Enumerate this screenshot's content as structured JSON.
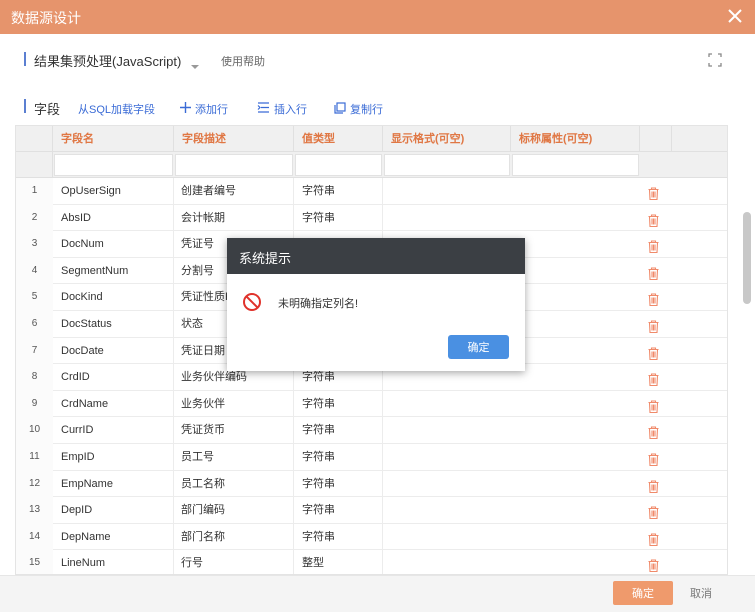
{
  "window": {
    "title": "数据源设计"
  },
  "section1": {
    "title": "结果集预处理(JavaScript)",
    "help": "使用帮助"
  },
  "section2": {
    "title": "字段",
    "tools": [
      "从SQL加载字段",
      "插入行",
      "插入行",
      "复制行"
    ]
  },
  "toolbar": {
    "load_sql": "从SQL加载字段",
    "add_row": "添加行",
    "insert_row": "插入行",
    "copy_row": "复制行"
  },
  "grid": {
    "headers": [
      "字段名",
      "字段描述",
      "值类型",
      "显示格式(可空)",
      "标称属性(可空)"
    ],
    "rows": [
      {
        "idx": "1",
        "name": "OpUserSign",
        "desc": "创建者编号",
        "type": "字符串"
      },
      {
        "idx": "2",
        "name": "AbsID",
        "desc": "会计帐期",
        "type": "字符串"
      },
      {
        "idx": "3",
        "name": "DocNum",
        "desc": "凭证号",
        "type": ""
      },
      {
        "idx": "4",
        "name": "SegmentNum",
        "desc": "分割号",
        "type": ""
      },
      {
        "idx": "5",
        "name": "DocKind",
        "desc": "凭证性质H",
        "type": ""
      },
      {
        "idx": "6",
        "name": "DocStatus",
        "desc": "状态",
        "type": ""
      },
      {
        "idx": "7",
        "name": "DocDate",
        "desc": "凭证日期",
        "type": ""
      },
      {
        "idx": "8",
        "name": "CrdID",
        "desc": "业务伙伴编码",
        "type": "字符串"
      },
      {
        "idx": "9",
        "name": "CrdName",
        "desc": "业务伙伴",
        "type": "字符串"
      },
      {
        "idx": "10",
        "name": "CurrID",
        "desc": "凭证货币",
        "type": "字符串"
      },
      {
        "idx": "11",
        "name": "EmpID",
        "desc": "员工号",
        "type": "字符串"
      },
      {
        "idx": "12",
        "name": "EmpName",
        "desc": "员工名称",
        "type": "字符串"
      },
      {
        "idx": "13",
        "name": "DepID",
        "desc": "部门编码",
        "type": "字符串"
      },
      {
        "idx": "14",
        "name": "DepName",
        "desc": "部门名称",
        "type": "字符串"
      },
      {
        "idx": "15",
        "name": "LineNum",
        "desc": "行号",
        "type": "整型"
      }
    ]
  },
  "footer": {
    "ok": "确定",
    "cancel": "取消"
  },
  "dialog": {
    "title": "系统提示",
    "message": "未明确指定列名!",
    "ok": "确定"
  },
  "colors": {
    "titlebar": "#e6946c",
    "accent": "#e07744",
    "link": "#3a6bd6",
    "dialog_header": "#3b3f44",
    "dialog_button": "#4a90e2",
    "delete_icon": "#f08a6a"
  }
}
